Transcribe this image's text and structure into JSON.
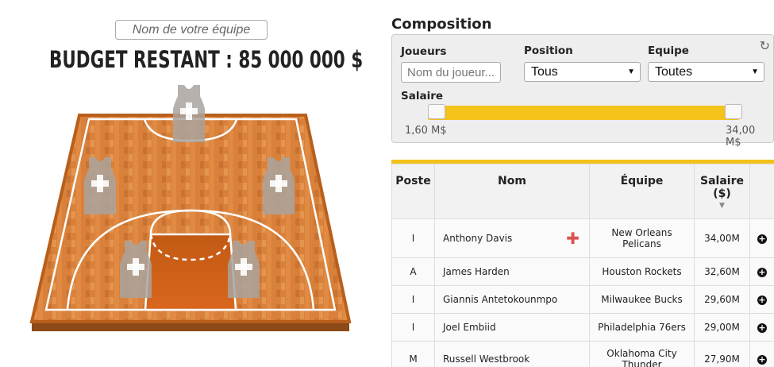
{
  "team": {
    "name_placeholder": "Nom de votre équipe"
  },
  "budget": {
    "label": "BUDGET RESTANT : 85 000 000 $"
  },
  "composition": {
    "title": "Composition",
    "filters": {
      "players_label": "Joueurs",
      "players_placeholder": "Nom du joueur...",
      "position_label": "Position",
      "position_value": "Tous",
      "team_label": "Equipe",
      "team_value": "Toutes",
      "salary_label": "Salaire",
      "salary_min": "1,60 M$",
      "salary_max": "34,00 M$"
    }
  },
  "table": {
    "headers": {
      "poste": "Poste",
      "nom": "Nom",
      "equipe": "Équipe",
      "salaire": "Salaire",
      "salaire_unit": "($)"
    },
    "rows": [
      {
        "poste": "I",
        "nom": "Anthony Davis",
        "equipe_line1": "New Orleans",
        "equipe_line2": "Pelicans",
        "salaire": "34,00M",
        "injured": true
      },
      {
        "poste": "A",
        "nom": "James Harden",
        "equipe_line1": "Houston Rockets",
        "equipe_line2": "",
        "salaire": "32,60M"
      },
      {
        "poste": "I",
        "nom": "Giannis Antetokounmpo",
        "equipe_line1": "Milwaukee Bucks",
        "equipe_line2": "",
        "salaire": "29,60M"
      },
      {
        "poste": "I",
        "nom": "Joel Embiid",
        "equipe_line1": "Philadelphia 76ers",
        "equipe_line2": "",
        "salaire": "29,00M"
      },
      {
        "poste": "M",
        "nom": "Russell Westbrook",
        "equipe_line1": "Oklahoma City",
        "equipe_line2": "Thunder",
        "salaire": "27,90M"
      }
    ]
  },
  "colors": {
    "accent": "#f5c219",
    "court_wood": "#d9803a",
    "court_border": "#b85f1c",
    "jersey": "#a9a39d"
  },
  "icons": {
    "refresh": "refresh-icon",
    "add": "plus-circle-icon",
    "injury": "injury-cross-icon"
  }
}
